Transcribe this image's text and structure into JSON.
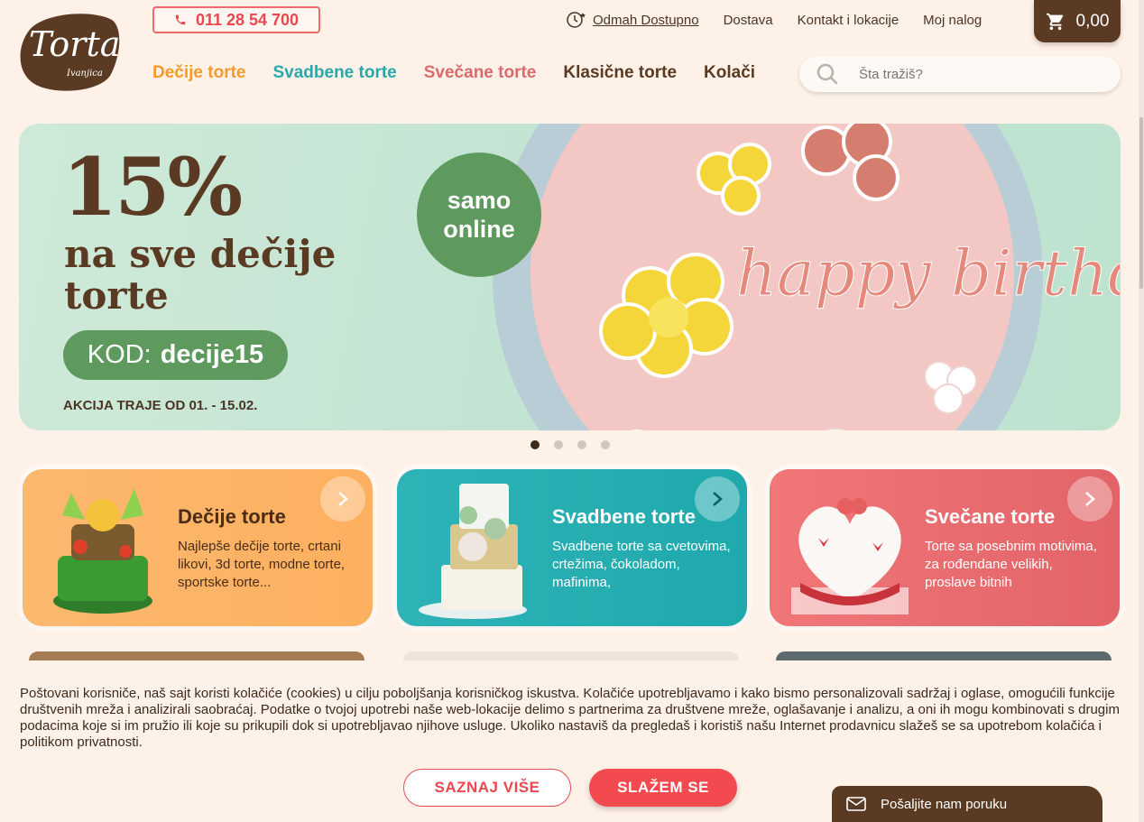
{
  "header": {
    "logo_text": "Torta",
    "logo_sub": "Ivanjica",
    "phone": "011 28 54 700",
    "top_links": [
      {
        "label": "Odmah Dostupno"
      },
      {
        "label": "Dostava"
      },
      {
        "label": "Kontakt i lokacije"
      },
      {
        "label": "Moj nalog"
      }
    ],
    "cart_total": "0,00",
    "nav": [
      {
        "label": "Dečije torte",
        "color": "#f59a2b"
      },
      {
        "label": "Svadbene torte",
        "color": "#2aa7a9"
      },
      {
        "label": "Svečane torte",
        "color": "#d86b6b"
      },
      {
        "label": "Klasične torte",
        "color": "#5a3a22"
      },
      {
        "label": "Kolači",
        "color": "#5a3a22"
      }
    ],
    "search_placeholder": "Šta tražiš?"
  },
  "hero": {
    "percent": "15%",
    "subtitle": "na sve dečije torte",
    "code_label": "KOD:",
    "code_value": "decije15",
    "promo_period": "AKCIJA TRAJE OD 01. - 15.02.",
    "badge_line1": "samo",
    "badge_line2": "online",
    "cake_text": "happy birthday",
    "slides_total": 4,
    "active_slide": 1
  },
  "categories": [
    {
      "title": "Dečije torte",
      "desc": "Najlepše dečije torte, crtani likovi, 3d torte, modne torte, sportske torte..."
    },
    {
      "title": "Svadbene torte",
      "desc": "Svadbene torte sa cvetovima, crtežima, čokoladom, mafinima,"
    },
    {
      "title": "Svečane torte",
      "desc": "Torte sa posebnim motivima, za rođendane velikih, proslave bitnih"
    }
  ],
  "cookie": {
    "text": "Poštovani korisniče, naš sajt koristi kolačiće (cookies) u cilju poboljšanja korisničkog iskustva. Kolačiće upotrebljavamo i kako bismo personalizovali sadržaj i oglase, omogućili funkcije društvenih mreža i analizirali saobraćaj. Podatke o tvojoj upotrebi naše web-lokacije delimo s partnerima za društvene mreže, oglašavanje i analizu, a oni ih mogu kombinovati s drugim podacima koje si im pružio ili koje su prikupili dok si upotrebljavao njihove usluge. Ukoliko nastaviš da pregledaš i koristiš našu Internet prodavnicu slažeš se sa upotrebom kolačića i politikom privatnosti.",
    "learn_more": "SAZNAJ VIŠE",
    "accept": "SLAŽEM SE"
  },
  "chat": {
    "label": "Pošaljite nam poruku"
  },
  "colors": {
    "brand_brown": "#5a3a22",
    "accent_red": "#f24a4e",
    "green": "#5e9a5e"
  }
}
